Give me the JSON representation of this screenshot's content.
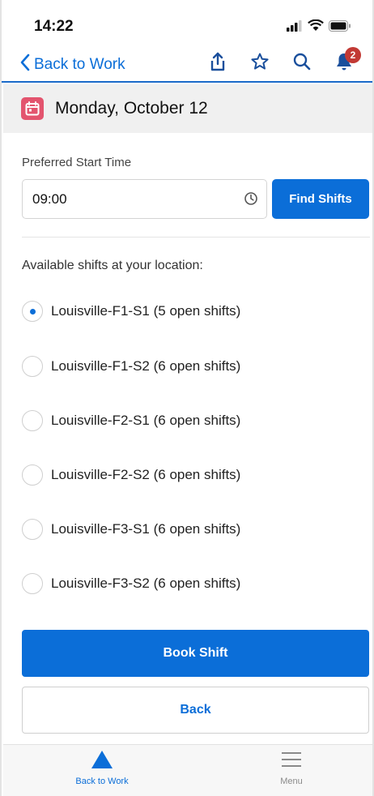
{
  "status_bar": {
    "time": "14:22"
  },
  "nav": {
    "back_label": "Back to Work",
    "notification_count": "2"
  },
  "date_header": {
    "date": "Monday, October 12"
  },
  "form": {
    "start_time_label": "Preferred Start Time",
    "start_time_value": "09:00",
    "find_button": "Find Shifts"
  },
  "shifts": {
    "heading": "Available shifts at your location:",
    "items": [
      {
        "label": "Louisville-F1-S1 (5 open shifts)",
        "selected": true
      },
      {
        "label": "Louisville-F1-S2 (6 open shifts)",
        "selected": false
      },
      {
        "label": "Louisville-F2-S1 (6 open shifts)",
        "selected": false
      },
      {
        "label": "Louisville-F2-S2 (6 open shifts)",
        "selected": false
      },
      {
        "label": "Louisville-F3-S1 (6 open shifts)",
        "selected": false
      },
      {
        "label": "Louisville-F3-S2 (6 open shifts)",
        "selected": false
      }
    ]
  },
  "actions": {
    "book_button": "Book Shift",
    "back_button": "Back"
  },
  "tabbar": {
    "tabs": [
      {
        "label": "Back to Work",
        "active": true,
        "icon": "triangle-icon"
      },
      {
        "label": "Menu",
        "active": false,
        "icon": "hamburger-menu-icon"
      }
    ]
  },
  "colors": {
    "accent": "#0b6ed8",
    "calendar": "#e3546e",
    "badge": "#c23934"
  }
}
